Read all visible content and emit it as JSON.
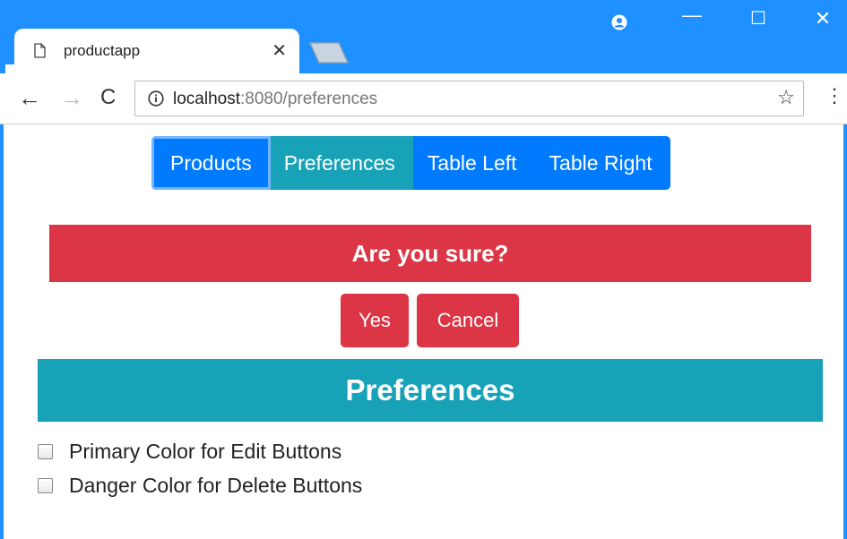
{
  "browser": {
    "tab_title": "productapp",
    "tab_close": "✕",
    "url_host": "localhost",
    "url_rest": ":8080/preferences",
    "back": "←",
    "forward": "→",
    "reload": "C",
    "star": "☆",
    "menu": "⋮",
    "minimize": "—",
    "maximize": "☐",
    "close": "✕"
  },
  "nav": {
    "items": [
      {
        "label": "Products"
      },
      {
        "label": "Preferences"
      },
      {
        "label": "Table Left"
      },
      {
        "label": "Table Right"
      }
    ]
  },
  "confirm": {
    "message": "Are you sure?",
    "yes_label": "Yes",
    "cancel_label": "Cancel"
  },
  "preferences": {
    "title": "Preferences",
    "options": [
      {
        "label": "Primary Color for Edit Buttons"
      },
      {
        "label": "Danger Color for Delete Buttons"
      }
    ]
  },
  "colors": {
    "primary": "#007bff",
    "info": "#17a2b8",
    "danger": "#dc3545",
    "chrome": "#1e90ff"
  }
}
